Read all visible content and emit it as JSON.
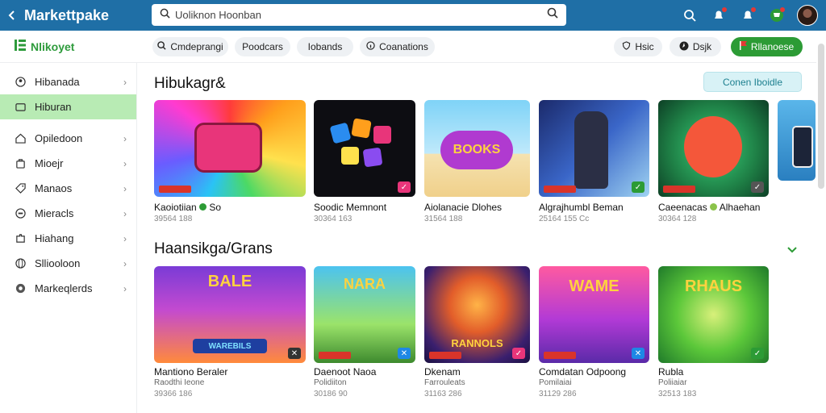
{
  "topbar": {
    "app_title": "Markettpake",
    "search_text": "Uoliknon Hoonban"
  },
  "subbar": {
    "logo_text": "Nlikoyet",
    "filters": [
      "Cmdeprangi",
      "Poodcars",
      "Iobands",
      "Coanations"
    ],
    "actions": {
      "help": "Hsic",
      "dark": "Dsjk",
      "primary": "Rllanoese"
    }
  },
  "sidebar": {
    "items": [
      {
        "label": "Hibanada",
        "icon": "user-icon"
      },
      {
        "label": "Hiburan",
        "icon": "home-icon"
      },
      {
        "label": "Opiledoon",
        "icon": "house-icon"
      },
      {
        "label": "Mioejr",
        "icon": "bag-icon"
      },
      {
        "label": "Manaos",
        "icon": "tag-icon"
      },
      {
        "label": "Mieracls",
        "icon": "gamepad-icon"
      },
      {
        "label": "Hiahang",
        "icon": "puzzle-icon"
      },
      {
        "label": "Slliooloon",
        "icon": "globe-icon"
      },
      {
        "label": "Markeqlerds",
        "icon": "circle-icon"
      }
    ]
  },
  "main": {
    "section1_title": "Hibukagr&",
    "cta_label": "Conen Iboidle",
    "row1": [
      {
        "title": "Kaoiotiian",
        "title_suffix": "So",
        "meta": "39564 188",
        "thumb_text": ""
      },
      {
        "title": "Soodic Memnont",
        "meta": "30364 163",
        "thumb_text": ""
      },
      {
        "title": "Aiolanacie Dlohes",
        "meta": "31564 188",
        "thumb_text": "BOOKS"
      },
      {
        "title": "Algrajhumbl Beman",
        "meta": "25164 155 Cc",
        "thumb_text": ""
      },
      {
        "title": "Caeenacas",
        "title_suffix": "Alhaehan",
        "meta": "30364 128",
        "thumb_text": ""
      }
    ],
    "section2_title": "Haansikga/Grans",
    "row2": [
      {
        "title": "Mantiono Beraler",
        "subtitle": "Raodthi Ieone",
        "meta": "39366 186",
        "thumb_text": "BALE",
        "thumb_text2": "WAREBILS"
      },
      {
        "title": "Daenoot Naoa",
        "subtitle": "Polidiiton",
        "meta": "30186 90",
        "thumb_text": "NARA",
        "thumb_text2": ""
      },
      {
        "title": "Dkenam",
        "subtitle": "Farrouleats",
        "meta": "31163 286",
        "thumb_text": "RANNOLS",
        "thumb_text2": ""
      },
      {
        "title": "Comdatan Odpoong",
        "subtitle": "Pomilaiai",
        "meta": "31129 286",
        "thumb_text": "WAME",
        "thumb_text2": ""
      },
      {
        "title": "Rubla",
        "subtitle": "Poliiaiar",
        "meta": "32513 183",
        "thumb_text": "RHAUS",
        "thumb_text2": ""
      }
    ]
  }
}
